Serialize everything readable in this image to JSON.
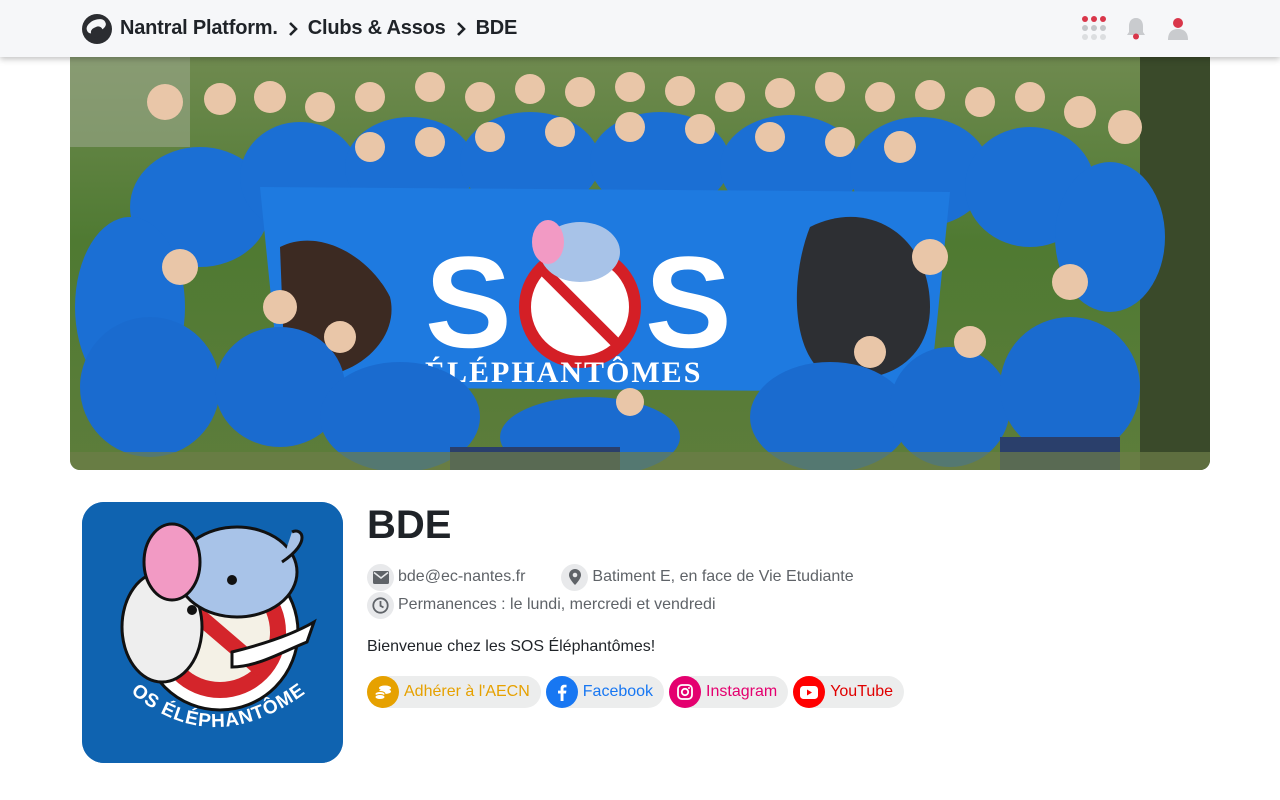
{
  "header": {
    "platform": "Nantral Platform.",
    "breadcrumbs": [
      "Clubs & Assos",
      "BDE"
    ],
    "icons": [
      "apps-grid-icon",
      "bell-icon",
      "user-icon"
    ],
    "accent_color": "#d9364a"
  },
  "banner": {
    "text_main": "SOS",
    "text_sub": "ÉLÉPHANTÔMES",
    "background_color": "#1e7ae0"
  },
  "club": {
    "name": "BDE",
    "email": "bde@ec-nantes.fr",
    "location": "Batiment E, en face de Vie Etudiante",
    "hours": "Permanences : le lundi, mercredi et vendredi",
    "description": "Bienvenue chez les SOS Éléphantômes!",
    "logo_text": "SOS ÉLÉPHANTÔMES",
    "logo_background": "#0f63b0"
  },
  "links": [
    {
      "label": "Adhérer à l'AECN",
      "icon": "coins-icon",
      "color": "#e6a100"
    },
    {
      "label": "Facebook",
      "icon": "facebook-icon",
      "color": "#1877f2"
    },
    {
      "label": "Instagram",
      "icon": "instagram-icon",
      "color": "#e4006f"
    },
    {
      "label": "YouTube",
      "icon": "youtube-icon",
      "color": "#ff0000"
    }
  ]
}
